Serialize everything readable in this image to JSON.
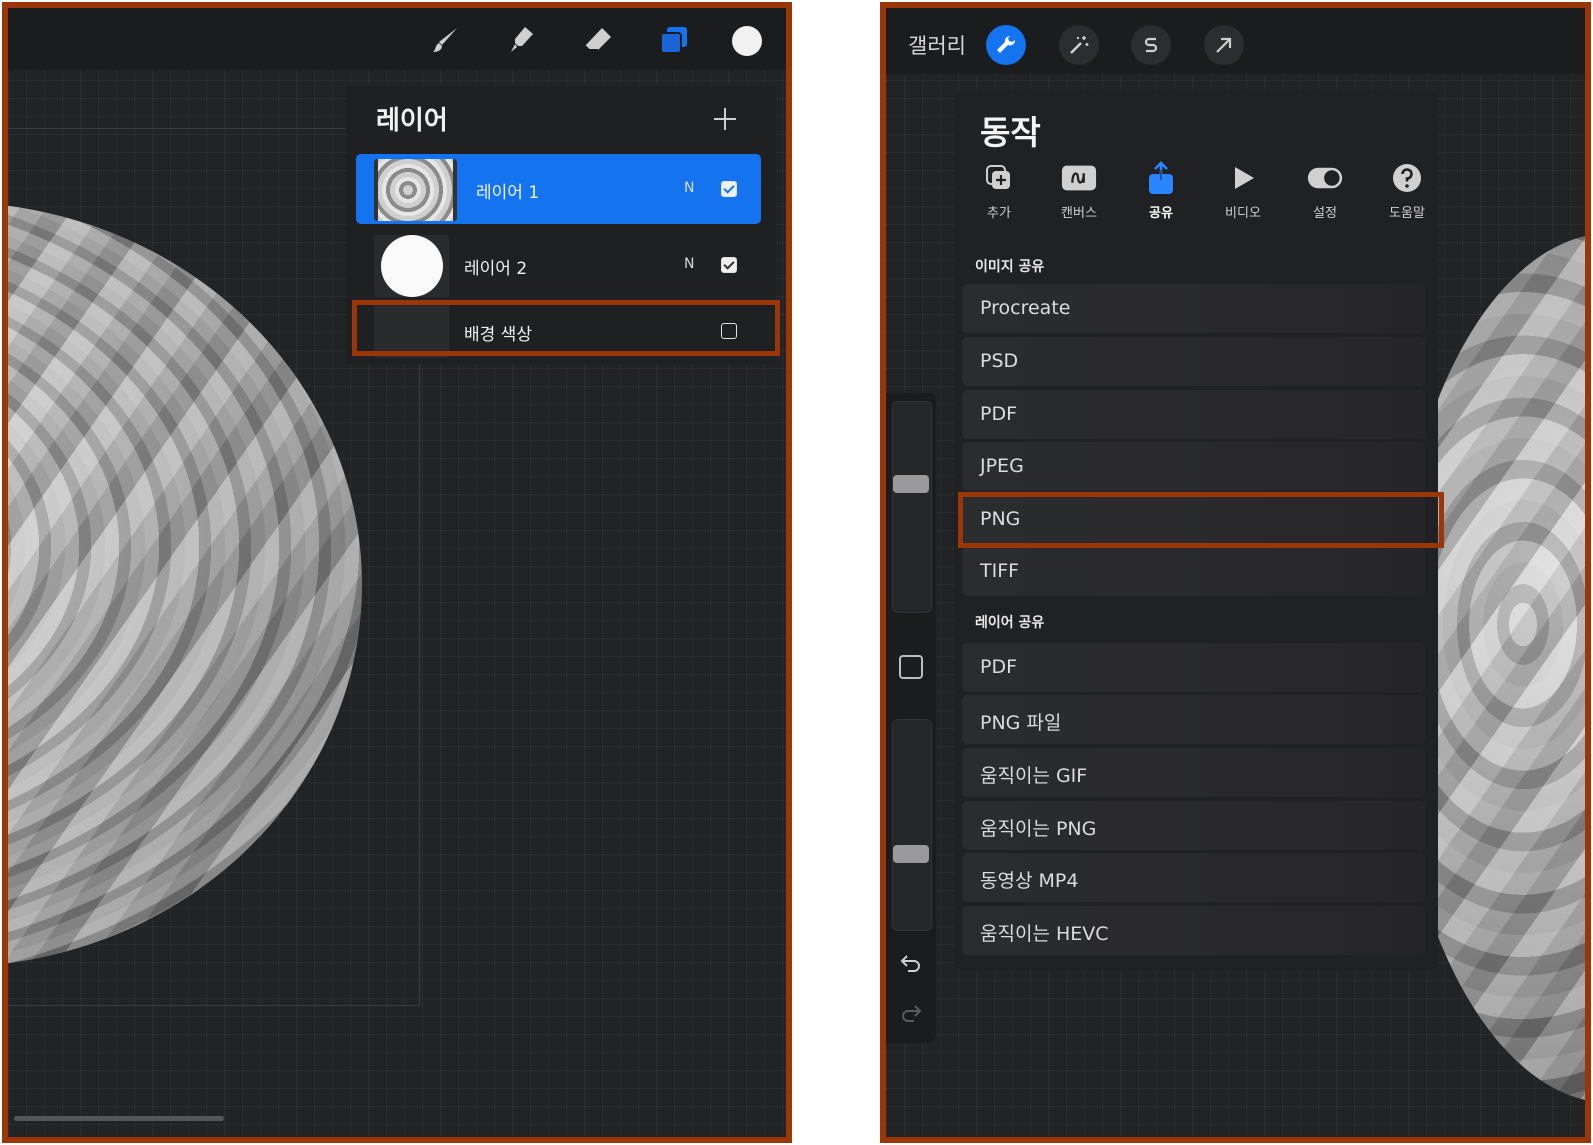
{
  "left_panel": {
    "toolbar": {
      "tools": [
        "brush-icon",
        "smudge-icon",
        "eraser-icon",
        "layers-icon"
      ],
      "active_tool": "layers-icon",
      "current_color": "#f1f1f1"
    },
    "layers": {
      "title": "레이어",
      "add_icon": "plus-icon",
      "items": [
        {
          "name": "레이어 1",
          "mode": "N",
          "visible": true,
          "selected": true
        },
        {
          "name": "레이어 2",
          "mode": "N",
          "visible": true,
          "selected": false
        },
        {
          "name": "배경 색상",
          "visible": false,
          "selected": false,
          "highlighted": true
        }
      ]
    }
  },
  "right_panel": {
    "topbar": {
      "gallery_label": "갤러리",
      "buttons": [
        "wrench-icon",
        "magic-wand-icon",
        "s-curve-icon",
        "arrow-icon"
      ],
      "active_button": "wrench-icon"
    },
    "actions": {
      "title": "동작",
      "tabs": [
        {
          "label": "추가",
          "icon": "add-icon"
        },
        {
          "label": "캔버스",
          "icon": "canvas-icon"
        },
        {
          "label": "공유",
          "icon": "share-icon",
          "active": true
        },
        {
          "label": "비디오",
          "icon": "play-icon"
        },
        {
          "label": "설정",
          "icon": "toggle-icon"
        },
        {
          "label": "도움말",
          "icon": "help-icon"
        }
      ],
      "image_share_label": "이미지 공유",
      "image_share": [
        "Procreate",
        "PSD",
        "PDF",
        "JPEG",
        "PNG",
        "TIFF"
      ],
      "highlighted_item": "PNG",
      "layer_share_label": "레이어 공유",
      "layer_share": [
        "PDF",
        "PNG 파일",
        "움직이는 GIF",
        "움직이는 PNG",
        "동영상 MP4",
        "움직이는 HEVC"
      ]
    },
    "sidebar": {
      "icons": [
        "undo-icon",
        "redo-icon"
      ]
    }
  },
  "colors": {
    "accent": "#1474f0",
    "highlight_border": "#9a3608",
    "background": "#222325"
  }
}
